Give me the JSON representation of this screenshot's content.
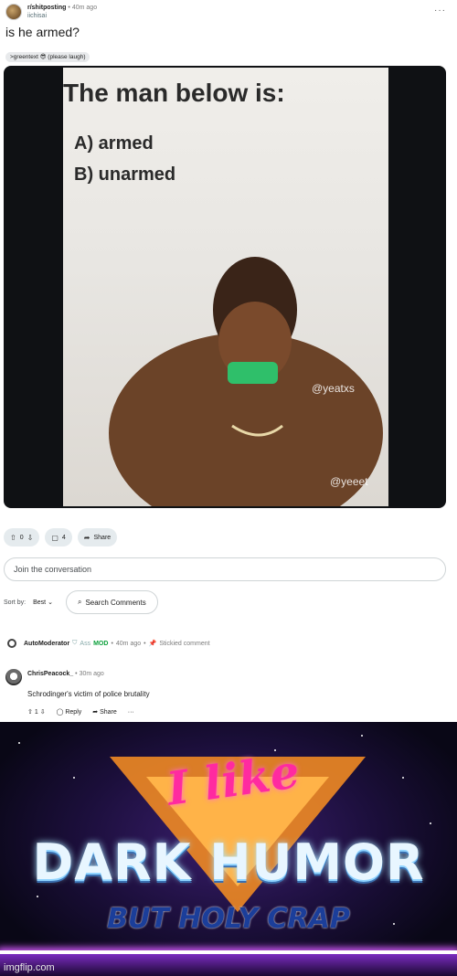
{
  "post": {
    "subreddit": "r/shitposting",
    "time": "40m ago",
    "author": "iichisai",
    "more": "···",
    "title": "is he armed?",
    "flair": ">greentext 😎 (please laugh)"
  },
  "media": {
    "question": "The man below is:",
    "option_a": "A) armed",
    "option_b": "B) unarmed",
    "watermark1": "@yeatxs",
    "watermark2": "@yeeet"
  },
  "actions": {
    "vote_count": "0",
    "comment_count": "4",
    "share_label": "Share"
  },
  "join_placeholder": "Join the conversation",
  "sort": {
    "label": "Sort by:",
    "value": "Best",
    "search_label": "Search Comments"
  },
  "automod": {
    "name": "AutoModerator",
    "mod_dim": "Ass",
    "mod_badge": "MOD",
    "time": "40m ago",
    "stickied": "Stickied comment"
  },
  "comment": {
    "author": "ChrisPeacock_",
    "time": "30m ago",
    "body": "Schrodinger's victim of police brutality",
    "votes": "1",
    "reply_label": "Reply",
    "share_label": "Share",
    "more": "···"
  },
  "meme2": {
    "script": "I like",
    "main": "DARK HUMOR",
    "sub": "BUT HOLY CRAP",
    "watermark": "imgflip.com"
  },
  "colors": {
    "mod_green": "#0a9f3a",
    "pill_bg": "#e5ebee",
    "media_bg": "#0f1114"
  }
}
